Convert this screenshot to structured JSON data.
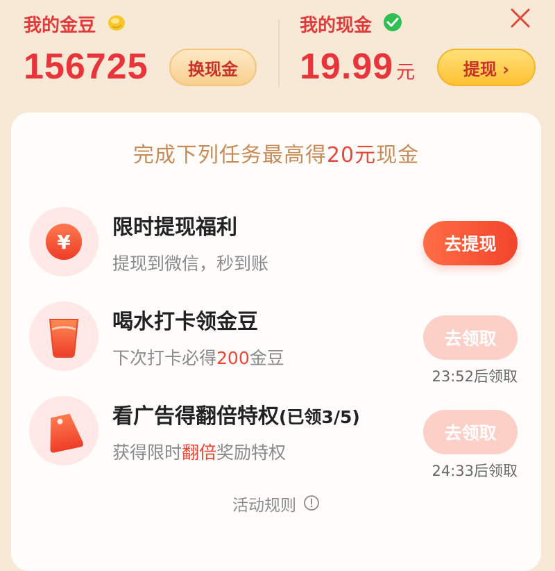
{
  "header": {
    "beans": {
      "label": "我的金豆",
      "value": "156725",
      "button": "换现金",
      "icon": "gold-bean-icon"
    },
    "cash": {
      "label": "我的现金",
      "value": "19.99",
      "unit": "元",
      "button": "提现 ›",
      "icon": "check-circle-icon"
    },
    "close_icon": "close-icon"
  },
  "card": {
    "title_prefix": "完成下列任务最高得",
    "title_highlight": "20元",
    "title_suffix": "现金",
    "tasks": [
      {
        "title": "限时提现福利",
        "desc": "提现到微信，秒到账",
        "action": "去提现",
        "icon": "yuan-coin-icon",
        "state": "active"
      },
      {
        "title": "喝水打卡领金豆",
        "desc_prefix": "下次打卡必得",
        "desc_highlight": "200",
        "desc_suffix": "金豆",
        "action": "去领取",
        "countdown": "23:52后领取",
        "icon": "water-cup-icon",
        "state": "disabled"
      },
      {
        "title": "看广告得翻倍特权",
        "title_sub": "(已领3/5)",
        "desc_prefix": "获得限时",
        "desc_highlight": "翻倍",
        "desc_suffix": "奖励特权",
        "action": "去领取",
        "countdown": "24:33后领取",
        "icon": "price-tag-icon",
        "state": "disabled"
      }
    ],
    "rules": "活动规则",
    "rules_icon": "info-icon"
  },
  "colors": {
    "accent_red": "#e8343a",
    "title_tan": "#c88b58",
    "button_gold": "#ffc232",
    "button_orange": "#f3442c",
    "background": "#f8e8d6"
  }
}
